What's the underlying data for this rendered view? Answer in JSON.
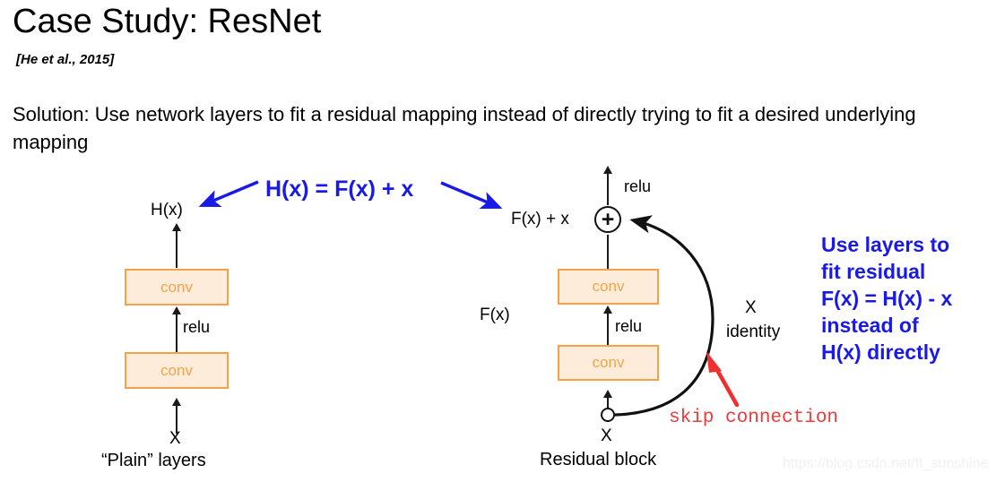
{
  "slide": {
    "title": "Case Study: ResNet",
    "citation": "[He et al., 2015]",
    "body": "Solution: Use network layers to fit a residual mapping instead of directly trying to fit a desired underlying mapping",
    "watermark": "https://blog.csdn.net/ft_sunshine"
  },
  "colors": {
    "accent_blue": "#1a1ae8",
    "conv_fill": "#fdecd9",
    "conv_border": "#f3a24a",
    "conv_text": "#f5a44c",
    "skip_red": "#ee3b3b",
    "line_black": "#1a1a1a",
    "watermark_gray": "#f1f1f1"
  },
  "plain_block": {
    "output_label": "H(x)",
    "conv_top_label": "conv",
    "relu_label": "relu",
    "conv_bottom_label": "conv",
    "input_label": "X",
    "caption": "“Plain” layers"
  },
  "residual_block": {
    "top_relu_label": "relu",
    "sum_output_label": "F(x) + x",
    "plus_symbol": "+",
    "conv_top_label": "conv",
    "inner_relu_label": "relu",
    "conv_bottom_label": "conv",
    "residual_fn_label": "F(x)",
    "identity_label_top": "X",
    "identity_label_bottom": "identity",
    "input_label": "X",
    "caption": "Residual block",
    "skip_connection_label": "skip connection"
  },
  "annotations": {
    "equation": "H(x) = F(x) + x",
    "note_lines": [
      "Use layers to",
      "fit residual",
      "F(x) = H(x) - x",
      "instead of",
      "H(x) directly"
    ]
  }
}
